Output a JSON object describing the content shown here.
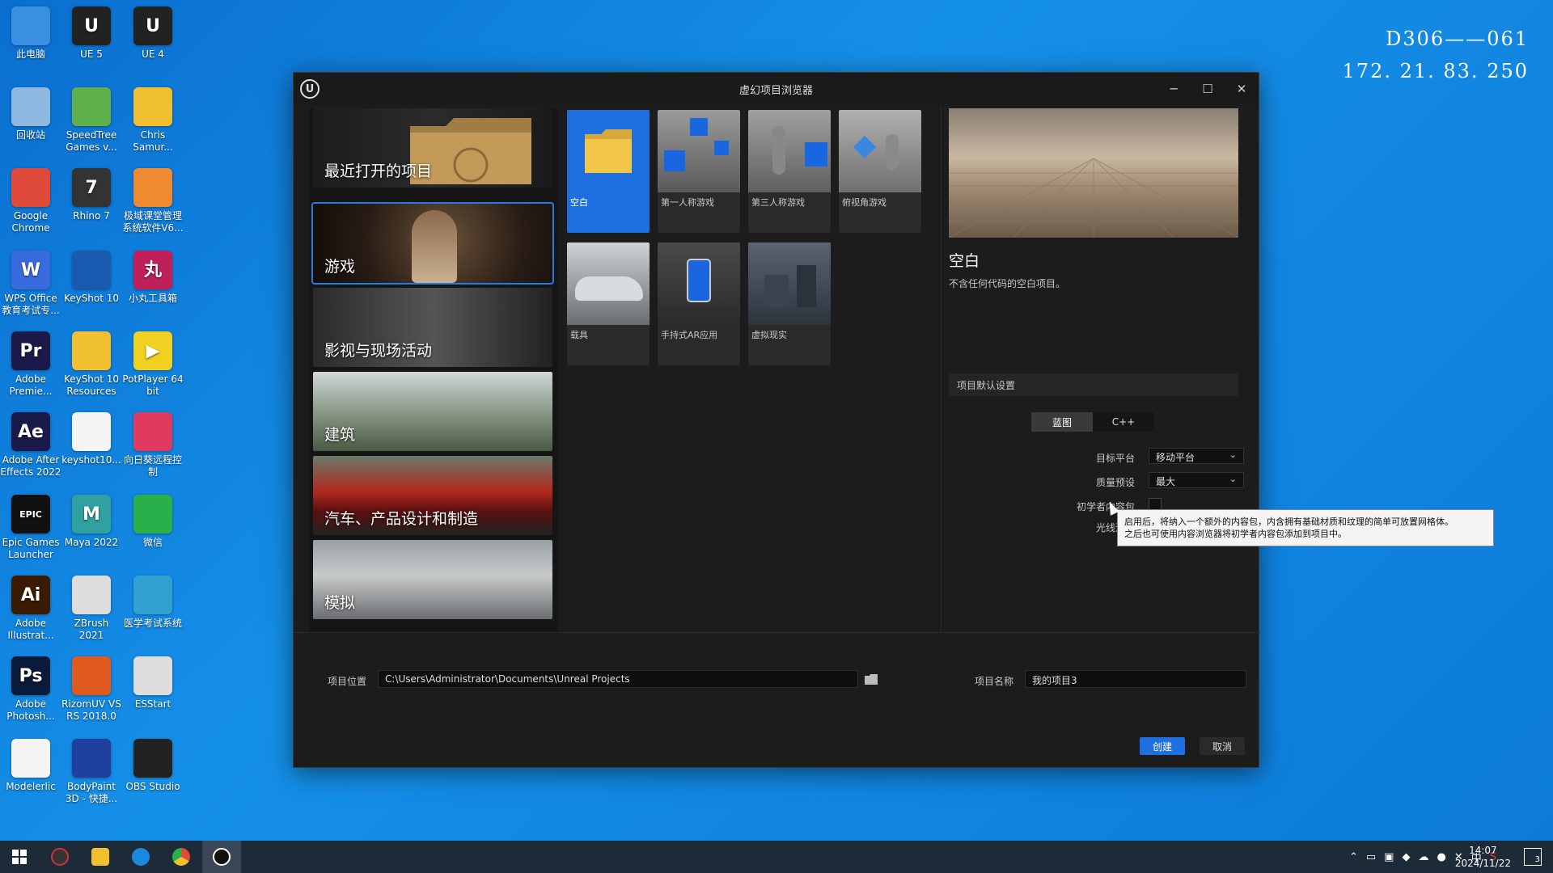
{
  "desktop": {
    "icons": [
      {
        "label": "此电脑",
        "color": "#3a8fe0",
        "glyph": ""
      },
      {
        "label": "UE 5",
        "color": "#222222",
        "glyph": "U"
      },
      {
        "label": "UE 4",
        "color": "#222222",
        "glyph": "U"
      },
      {
        "label": "回收站",
        "color": "#8fb8e0",
        "glyph": ""
      },
      {
        "label": "SpeedTree Games v...",
        "color": "#5fb04a",
        "glyph": ""
      },
      {
        "label": "Chris Samur...",
        "color": "#f0c030",
        "glyph": ""
      },
      {
        "label": "Google Chrome",
        "color": "#e04a3a",
        "glyph": ""
      },
      {
        "label": "Rhino 7",
        "color": "#333333",
        "glyph": "7"
      },
      {
        "label": "极域课堂管理系统软件V6...",
        "color": "#f08a30",
        "glyph": ""
      },
      {
        "label": "WPS Office 教育考试专...",
        "color": "#3a6ae0",
        "glyph": "W"
      },
      {
        "label": "KeyShot 10",
        "color": "#1a5ab0",
        "glyph": ""
      },
      {
        "label": "小丸工具箱",
        "color": "#c0205a",
        "glyph": "丸"
      },
      {
        "label": "Adobe Premie...",
        "color": "#1a1a4a",
        "glyph": "Pr"
      },
      {
        "label": "KeyShot 10 Resources",
        "color": "#f0c030",
        "glyph": ""
      },
      {
        "label": "PotPlayer 64 bit",
        "color": "#f0d020",
        "glyph": "▶"
      },
      {
        "label": "Adobe After Effects 2022",
        "color": "#1a1a4a",
        "glyph": "Ae"
      },
      {
        "label": "keyshot10...",
        "color": "#f4f4f4",
        "glyph": ""
      },
      {
        "label": "向日葵远程控制",
        "color": "#e03a60",
        "glyph": ""
      },
      {
        "label": "Epic Games Launcher",
        "color": "#111111",
        "glyph": "EPIC"
      },
      {
        "label": "Maya 2022",
        "color": "#30a0a0",
        "glyph": "M"
      },
      {
        "label": "微信",
        "color": "#2ab04a",
        "glyph": ""
      },
      {
        "label": "Adobe Illustrat...",
        "color": "#3a1a00",
        "glyph": "Ai"
      },
      {
        "label": "ZBrush 2021",
        "color": "#dddddd",
        "glyph": ""
      },
      {
        "label": "医学考试系统",
        "color": "#30a0d0",
        "glyph": ""
      },
      {
        "label": "Adobe Photosh...",
        "color": "#0a1a3a",
        "glyph": "Ps"
      },
      {
        "label": "RizomUV VS RS 2018.0",
        "color": "#e05a20",
        "glyph": ""
      },
      {
        "label": "ESStart",
        "color": "#dddddd",
        "glyph": ""
      },
      {
        "label": "Modelerlic",
        "color": "#f4f4f4",
        "glyph": ""
      },
      {
        "label": "BodyPaint 3D - 快捷...",
        "color": "#2040a0",
        "glyph": ""
      },
      {
        "label": "OBS Studio",
        "color": "#222222",
        "glyph": ""
      }
    ]
  },
  "watermark": {
    "line1": "D306——061",
    "line2": "172. 21. 83. 250"
  },
  "window": {
    "title": "虚幻项目浏览器",
    "controls": {
      "minimize": "─",
      "maximize": "☐",
      "close": "✕"
    },
    "logo": "U"
  },
  "categories": [
    {
      "label": "最近打开的项目"
    },
    {
      "label": "游戏"
    },
    {
      "label": "影视与现场活动"
    },
    {
      "label": "建筑"
    },
    {
      "label": "汽车、产品设计和制造"
    },
    {
      "label": "模拟"
    }
  ],
  "templates": [
    {
      "label": "空白"
    },
    {
      "label": "第一人称游戏"
    },
    {
      "label": "第三人称游戏"
    },
    {
      "label": "俯视角游戏"
    },
    {
      "label": "载具"
    },
    {
      "label": "手持式AR应用"
    },
    {
      "label": "虚拟现实"
    }
  ],
  "detail": {
    "title": "空白",
    "description": "不含任何代码的空白项目。"
  },
  "settings": {
    "header": "项目默认设置",
    "lang_blueprint": "蓝图",
    "lang_cpp": "C++",
    "target_platform_label": "目标平台",
    "target_platform_value": "移动平台",
    "quality_label": "质量预设",
    "quality_value": "最大",
    "starter_label": "初学者内容包",
    "raytracing_label": "光线追踪",
    "tooltip_line1": "启用后，将纳入一个额外的内容包，内含拥有基础材质和纹理的简单可放置网格体。",
    "tooltip_line2": "之后也可使用内容浏览器将初学者内容包添加到项目中。"
  },
  "bottom": {
    "location_label": "项目位置",
    "location_value": "C:\\Users\\Administrator\\Documents\\Unreal Projects",
    "name_label": "项目名称",
    "name_value": "我的项目3",
    "create": "创建",
    "cancel": "取消"
  },
  "taskbar": {
    "time": "14:07",
    "date": "2024/11/22",
    "ime": "中",
    "notifications": "3"
  }
}
